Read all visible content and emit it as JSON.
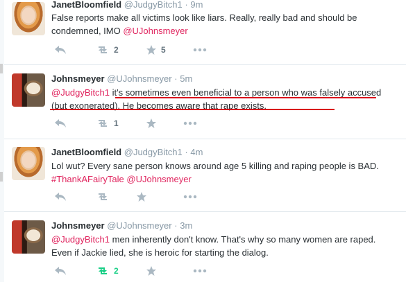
{
  "tweets": [
    {
      "name": "JanetBloomfield",
      "handle": "@JudgyBitch1",
      "time": "9m",
      "text_before": "False reports make all victims look like liars. Really, really bad and should be condemned, IMO  ",
      "mention_end": "@UJohnsmeyer",
      "retweets": "2",
      "favorites": "5"
    },
    {
      "name": "Johnsmeyer",
      "handle": "@UJohnsmeyer",
      "time": "5m",
      "mention_start": "@JudgyBitch1",
      "text_after": " it's sometimes even beneficial to a person who was falsely accused (but exonerated). He becomes aware that rape exists.",
      "retweets": "1",
      "favorites": ""
    },
    {
      "name": "JanetBloomfield",
      "handle": "@JudgyBitch1",
      "time": "4m",
      "text_before": "Lol wut? Every sane person knows around age 5 killing and raping people is BAD. ",
      "hashtag": "#ThankAFairyTale",
      "mention_end": " @UJohnsmeyer",
      "retweets": "",
      "favorites": ""
    },
    {
      "name": "Johnsmeyer",
      "handle": "@UJohnsmeyer",
      "time": "3m",
      "mention_start": "@JudgyBitch1",
      "text_after": " men inherently don't know. That's why so many women are raped. Even if Jackie lied, she is heroic for starting the dialog.",
      "retweets": "2",
      "favorites": ""
    }
  ],
  "colors": {
    "link": "#e0245e",
    "muted": "#8899a6",
    "retweet_active": "#19cf86",
    "annotation_underline": "#d9001b"
  },
  "icons": [
    "reply-icon",
    "retweet-icon",
    "favorite-icon",
    "more-icon"
  ]
}
